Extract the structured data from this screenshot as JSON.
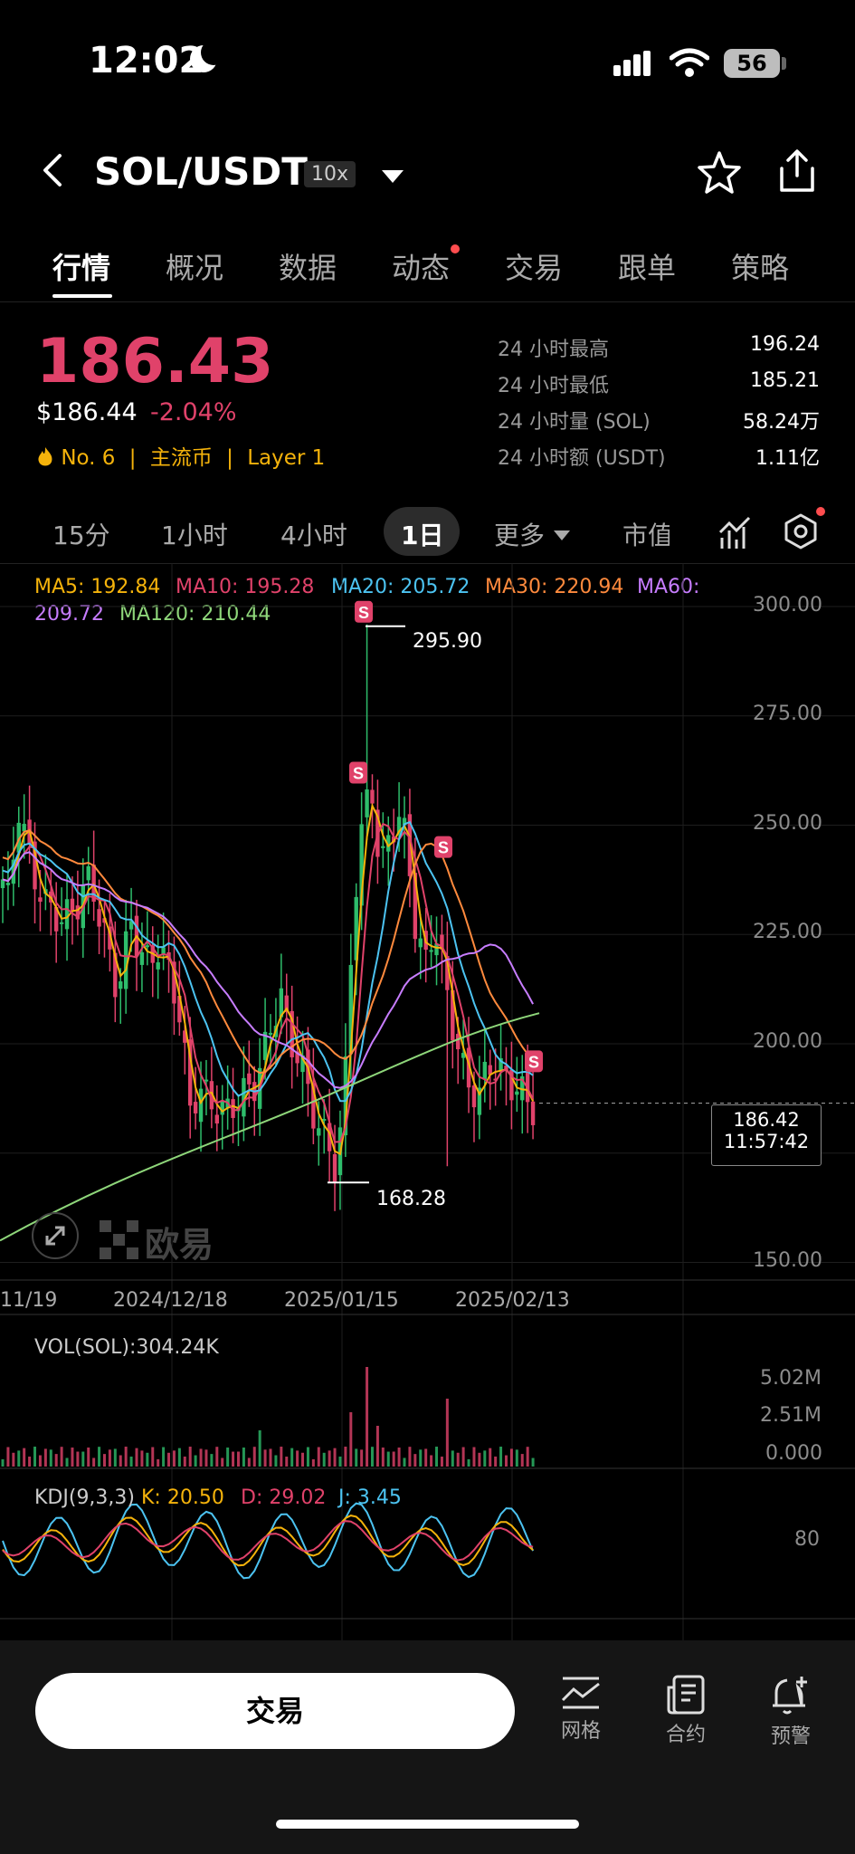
{
  "status": {
    "time": "12:02",
    "battery": "56"
  },
  "header": {
    "pair": "SOL/USDT",
    "leverage": "10x"
  },
  "tabs": [
    "行情",
    "概况",
    "数据",
    "动态",
    "交易",
    "跟单",
    "策略"
  ],
  "ticker": {
    "price": "186.43",
    "usd_price": "$186.44",
    "change": "-2.04%",
    "rank": "No. 6",
    "tag1": "主流币",
    "tag2": "Layer 1",
    "stats": [
      {
        "label": "24 小时最高",
        "value": "196.24"
      },
      {
        "label": "24 小时最低",
        "value": "185.21"
      },
      {
        "label": "24 小时量 (SOL)",
        "value": "58.24万"
      },
      {
        "label": "24 小时额 (USDT)",
        "value": "1.11亿"
      }
    ]
  },
  "intervals": [
    "15分",
    "1小时",
    "4小时",
    "1日",
    "更多",
    "市值"
  ],
  "ma_legend": {
    "ma5": "MA5: 192.84",
    "ma10": "MA10: 195.28",
    "ma20": "MA20: 205.72",
    "ma30": "MA30: 220.94",
    "ma60_a": "MA60:",
    "ma60_b": "209.72",
    "ma120": "MA120: 210.44"
  },
  "chart_data": {
    "type": "candlestick",
    "y_ticks": [
      "300.00",
      "275.00",
      "250.00",
      "225.00",
      "200.00",
      "150.00"
    ],
    "x_ticks": [
      "11/19",
      "2024/12/18",
      "2025/01/15",
      "2025/02/13"
    ],
    "high_marker": "295.90",
    "low_marker": "168.28",
    "current_price": "186.42",
    "current_time": "11:57:42",
    "watermark": "欧易",
    "colors": {
      "up": "#2ebd6b",
      "down": "#e0426a",
      "ma5": "#f5b30b",
      "ma10": "#e0426a",
      "ma20": "#4cc3f1",
      "ma30": "#ff8a3d",
      "ma60": "#c77dff",
      "ma120": "#8ed67a"
    }
  },
  "volume": {
    "label": "VOL(SOL):304.24K",
    "ticks": [
      "5.02M",
      "2.51M",
      "0.000"
    ]
  },
  "kdj": {
    "label": "KDJ(9,3,3)",
    "k": "K: 20.50",
    "d": "D: 29.02",
    "j": "J: 3.45",
    "tick": "80"
  },
  "bottom": {
    "trade": "交易",
    "grid": "网格",
    "contract": "合约",
    "alert": "预警"
  }
}
